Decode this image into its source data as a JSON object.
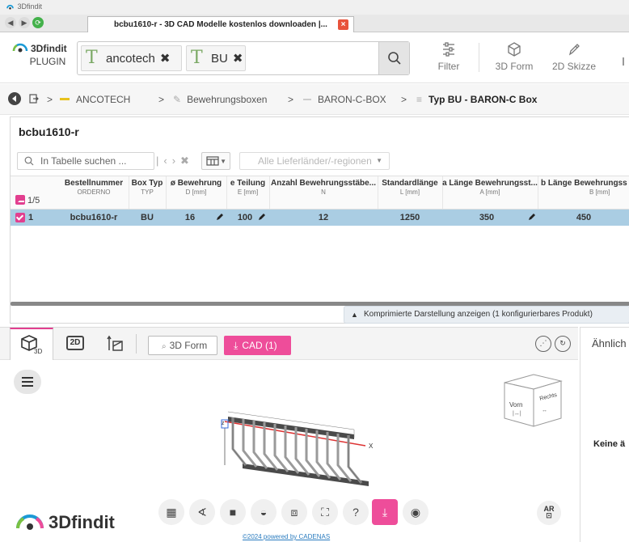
{
  "window": {
    "title": "3Dfindit"
  },
  "browser": {
    "tab_title": "bcbu1610-r - 3D CAD Modelle kostenlos downloaden |...",
    "tab_close": "×"
  },
  "plugin": {
    "brand": "3Dfindit",
    "label": "PLUGIN",
    "search_chips": [
      {
        "text": "ancotech",
        "remove": "✖"
      },
      {
        "text": "BU",
        "remove": "✖"
      }
    ],
    "tools": {
      "filter": "Filter",
      "form3d": "3D Form",
      "sketch2d": "2D Skizze"
    }
  },
  "breadcrumb": {
    "separator": ">",
    "items": [
      "ANCOTECH",
      "Bewehrungsboxen",
      "BARON-C-BOX",
      "Typ BU - BARON-C Box"
    ]
  },
  "table_card": {
    "title": "bcbu1610-r",
    "search_placeholder": "In Tabelle suchen ...",
    "country_placeholder": "Alle Lieferländer/-regionen",
    "pagination": "1/5",
    "columns": [
      {
        "label": "Bestellnummer",
        "sub": "ORDERNO"
      },
      {
        "label": "Box Typ",
        "sub": "TYP"
      },
      {
        "label": "ø Bewehrung",
        "sub": "D [mm]"
      },
      {
        "label": "e Teilung",
        "sub": "E [mm]"
      },
      {
        "label": "Anzahl Bewehrungsstäbe...",
        "sub": "N"
      },
      {
        "label": "Standardlänge",
        "sub": "L [mm]"
      },
      {
        "label": "a Länge Bewehrungsst...",
        "sub": "A [mm]"
      },
      {
        "label": "b Länge Bewehrungss",
        "sub": "B [mm]"
      }
    ],
    "row": {
      "index": "1",
      "cells": [
        "bcbu1610-r",
        "BU",
        "16",
        "100",
        "12",
        "1250",
        "350",
        "450"
      ]
    },
    "compressed_notice": "Komprimierte Darstellung anzeigen (1 konfigurierbares Produkt)"
  },
  "viewer": {
    "tab_2d": "2D",
    "btn_3dform": "3D Form",
    "btn_cad": "CAD (1)",
    "axis_z": "z",
    "axis_x": "X",
    "cube_front": "Vorn",
    "cube_right": "Rechts",
    "ar_label": "AR",
    "powered": "©2024 powered by CADENAS",
    "logo": "3Dfindit"
  },
  "right_panel": {
    "title": "Ähnlich",
    "empty_text": "Keine ä"
  },
  "colors": {
    "accent_pink": "#ee4d9a",
    "selected_row": "#aacde3",
    "breadcrumb_yellow": "#e8c21d"
  }
}
